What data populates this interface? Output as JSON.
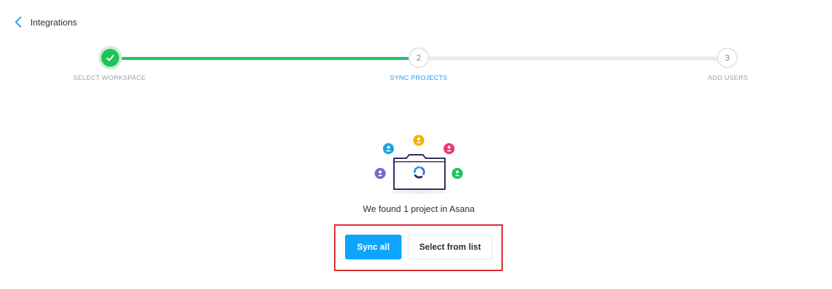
{
  "header": {
    "back_label": "Integrations"
  },
  "stepper": {
    "steps": [
      {
        "label": "SELECT WORKSPACE",
        "status": "complete"
      },
      {
        "label": "SYNC PROJECTS",
        "number": "2",
        "status": "active"
      },
      {
        "label": "ADD USERS",
        "number": "3",
        "status": "pending"
      }
    ],
    "progress_color": "#1fc35c",
    "active_color": "#2196f3"
  },
  "main": {
    "message": "We found 1 project in Asana",
    "actions": {
      "sync_all_label": "Sync all",
      "select_from_list_label": "Select from list"
    }
  },
  "illustration": {
    "avatar_colors": [
      "#7b68c8",
      "#1aa7e0",
      "#f3b400",
      "#f0386b",
      "#1fc35c"
    ],
    "icons": [
      "folder-icon",
      "asana-logo-icon",
      "user-avatar-icon"
    ]
  },
  "colors": {
    "primary": "#0ea5ff",
    "highlight": "#d9262d"
  }
}
